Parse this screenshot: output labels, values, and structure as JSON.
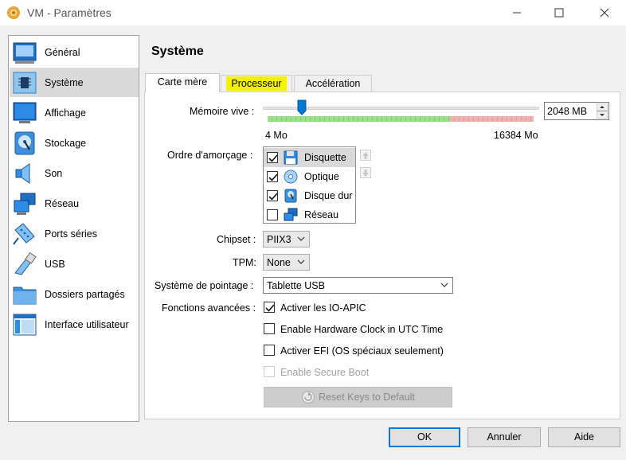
{
  "window": {
    "title": "VM - Paramètres"
  },
  "sidebar": {
    "items": [
      {
        "label": "Général",
        "icon": "general-icon"
      },
      {
        "label": "Système",
        "icon": "chip-icon"
      },
      {
        "label": "Affichage",
        "icon": "monitor-icon"
      },
      {
        "label": "Stockage",
        "icon": "disk-icon"
      },
      {
        "label": "Son",
        "icon": "speaker-icon"
      },
      {
        "label": "Réseau",
        "icon": "network-icon"
      },
      {
        "label": "Ports séries",
        "icon": "serial-port-icon"
      },
      {
        "label": "USB",
        "icon": "usb-icon"
      },
      {
        "label": "Dossiers partagés",
        "icon": "folder-icon"
      },
      {
        "label": "Interface utilisateur",
        "icon": "ui-icon"
      }
    ],
    "selected": "Système"
  },
  "page": {
    "title": "Système"
  },
  "tabs": [
    {
      "label": "Carte mère",
      "active": true
    },
    {
      "label": "Processeur",
      "highlighted": true
    },
    {
      "label": "Accélération"
    }
  ],
  "memory": {
    "label": "Mémoire vive :",
    "value": "2048 MB",
    "min_label": "4 Mo",
    "max_label": "16384 Mo",
    "fraction": 0.125
  },
  "boot_order": {
    "label": "Ordre d'amorçage :",
    "items": [
      {
        "label": "Disquette",
        "checked": true,
        "icon": "floppy-icon"
      },
      {
        "label": "Optique",
        "checked": true,
        "icon": "optical-disc-icon"
      },
      {
        "label": "Disque dur",
        "checked": true,
        "icon": "hard-disk-icon"
      },
      {
        "label": "Réseau",
        "checked": false,
        "icon": "network-icon"
      }
    ]
  },
  "chipset": {
    "label": "Chipset :",
    "value": "PIIX3"
  },
  "tpm": {
    "label": "TPM:",
    "value": "None"
  },
  "pointing": {
    "label": "Système de pointage :",
    "value": "Tablette USB"
  },
  "advanced": {
    "label": "Fonctions avancées :",
    "options": [
      {
        "label": "Activer les IO-APIC",
        "checked": true,
        "enabled": true
      },
      {
        "label": "Enable Hardware Clock in UTC Time",
        "checked": false,
        "enabled": true
      },
      {
        "label": "Activer EFI (OS spéciaux seulement)",
        "checked": false,
        "enabled": true
      },
      {
        "label": "Enable Secure Boot",
        "checked": false,
        "enabled": false
      }
    ]
  },
  "reset_keys": {
    "label": "Reset Keys to Default"
  },
  "buttons": {
    "ok": "OK",
    "cancel": "Annuler",
    "help": "Aide"
  },
  "colors": {
    "accent": "#0078d7",
    "tab_highlight": "#f4f200",
    "scale_green": "#9be08a",
    "scale_red": "#f3b2b2"
  }
}
